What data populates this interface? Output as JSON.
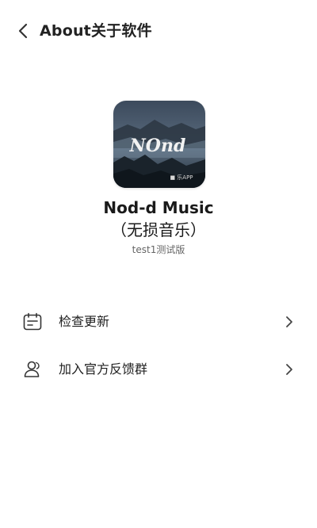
{
  "header": {
    "back_icon": "chevron-left-icon",
    "title": "About关于软件"
  },
  "app": {
    "logo_icon": "app-logo",
    "logo_text": "NOnd",
    "logo_badge": "■ 乐APP",
    "name": "Nod-d Music",
    "subtitle": "（无损音乐）",
    "version": "test1测试版"
  },
  "menu": {
    "items": [
      {
        "icon": "calendar-update-icon",
        "label": "检查更新",
        "arrow": "chevron-right-icon"
      },
      {
        "icon": "user-group-icon",
        "label": "加入官方反馈群",
        "arrow": "chevron-right-icon"
      }
    ]
  },
  "colors": {
    "background": "#ffffff",
    "text_primary": "#1f1f1f",
    "text_secondary": "#666666",
    "icon": "#333333"
  }
}
